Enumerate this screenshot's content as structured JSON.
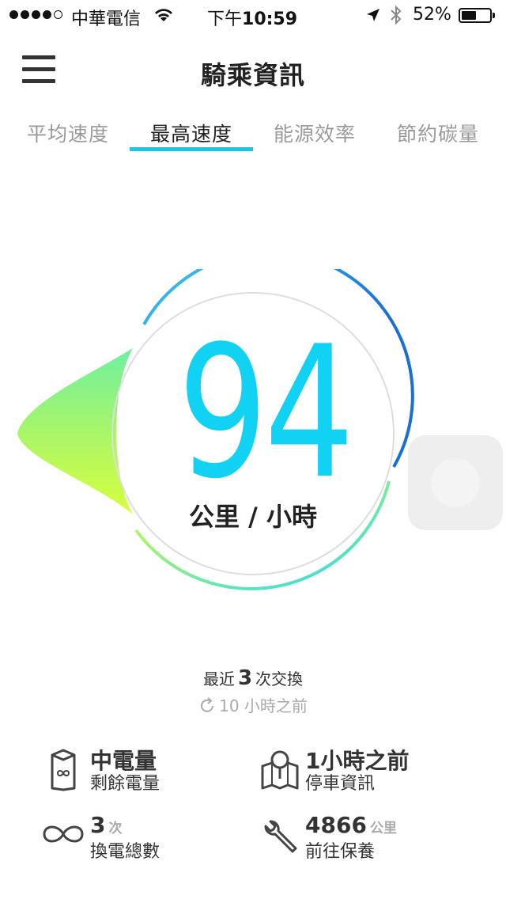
{
  "status_bar": {
    "carrier": "中華電信",
    "time_prefix": "下午",
    "time": "10:59",
    "battery_percent": "52%",
    "battery_level": 0.52
  },
  "header": {
    "title": "騎乘資訊",
    "menu_icon": "hamburger-menu-icon"
  },
  "tabs": [
    {
      "label": "平均速度",
      "active": false
    },
    {
      "label": "最高速度",
      "active": true
    },
    {
      "label": "能源效率",
      "active": false
    },
    {
      "label": "節約碳量",
      "active": false
    }
  ],
  "gauge": {
    "value": "94",
    "unit": "公里 / 小時"
  },
  "swap": {
    "prefix": "最近",
    "count": "3",
    "suffix": "次交換",
    "time_ago": "10 小時之前"
  },
  "stats": {
    "battery": {
      "title": "中電量",
      "label": "剩餘電量"
    },
    "parking": {
      "title": "1小時之前",
      "label": "停車資訊"
    },
    "swaps": {
      "value": "3",
      "unit": "次",
      "label": "換電總數"
    },
    "service": {
      "value": "4866",
      "unit": "公里",
      "label": "前往保養"
    }
  },
  "colors": {
    "accent": "#1ec3ea",
    "speed_text": "#12d2f4",
    "gradient_green": "#6ef0a0",
    "gradient_lime": "#d8ff3c",
    "gradient_blue": "#1a6fd6"
  }
}
